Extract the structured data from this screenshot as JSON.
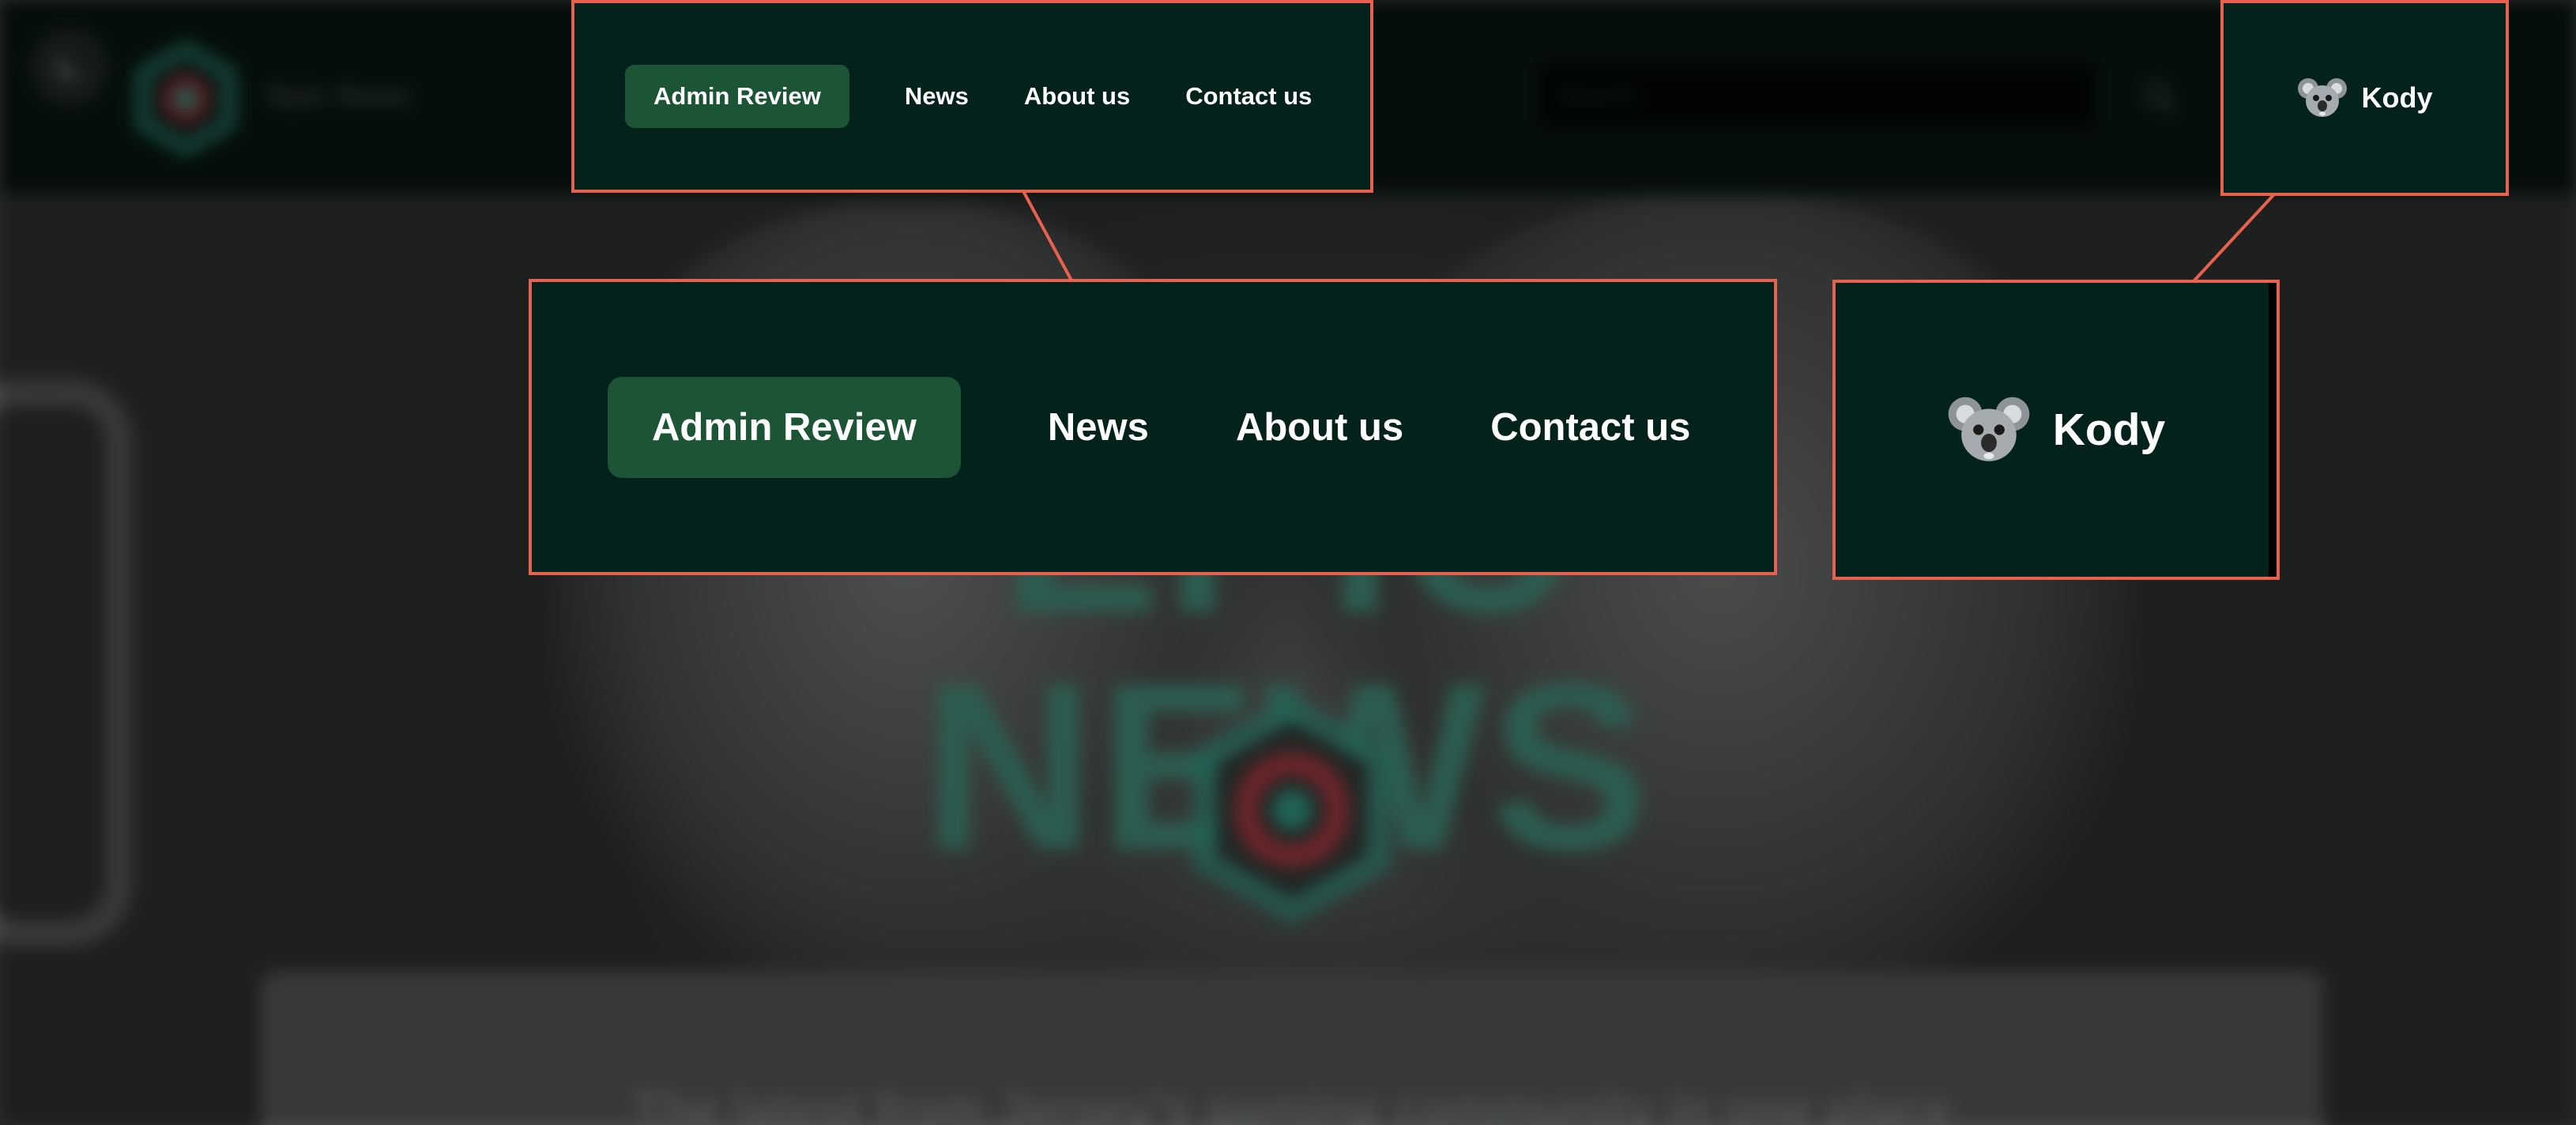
{
  "header": {
    "brand_name": "Epic News",
    "search_placeholder": "Search"
  },
  "nav": {
    "items": [
      {
        "label": "Admin Review",
        "active": true
      },
      {
        "label": "News",
        "active": false
      },
      {
        "label": "About us",
        "active": false
      },
      {
        "label": "Contact us",
        "active": false
      }
    ]
  },
  "user": {
    "name": "Kody",
    "avatar_icon": "koala-avatar"
  },
  "hero": {
    "title": "EPIC NEWS",
    "tagline": "The latest from Jersey's gaming community in one place"
  },
  "colors": {
    "callout_border": "#e8614f",
    "nav_background": "#04221c",
    "active_pill": "#1b5535",
    "brand_teal": "#2e8a78",
    "brand_red": "#b5343f"
  },
  "icons": {
    "theme_toggle": "theme-toggle-icon",
    "logo": "epic-news-logo-icon",
    "search": "search-icon"
  }
}
